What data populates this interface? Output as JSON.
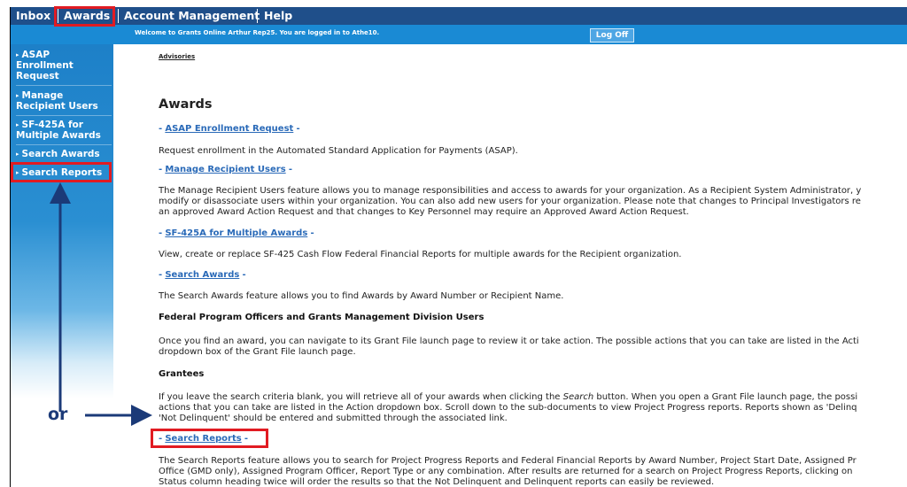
{
  "tabs": [
    {
      "label": "Inbox"
    },
    {
      "label": "Awards"
    },
    {
      "label": "Account Management"
    },
    {
      "label": "Help"
    }
  ],
  "welcome": {
    "text": "Welcome to Grants Online Arthur Rep25. You are logged in to Athe10.",
    "logoff_label": "Log Off"
  },
  "sidebar": {
    "items": [
      {
        "line1": "ASAP",
        "line2": "Enrollment",
        "line3": "Request"
      },
      {
        "line1": "Manage",
        "line2": "Recipient Users"
      },
      {
        "line1": "SF-425A for",
        "line2": "Multiple Awards"
      },
      {
        "line1": "Search Awards"
      },
      {
        "line1": "Search Reports"
      }
    ]
  },
  "content": {
    "advisories": "Advisories",
    "heading": "Awards",
    "asap_link": "ASAP Enrollment Request",
    "asap_desc": "Request enrollment in the Automated Standard Application for Payments (ASAP).",
    "manage_link": "Manage Recipient Users",
    "manage_desc1": "The Manage Recipient Users feature allows you to manage responsibilities and access to awards for your organization. As a Recipient System Administrator, y",
    "manage_desc2": "modify or disassociate users within your organization. You can also add new users for your organization. Please note that changes to Principal Investigators re",
    "manage_desc3": "an approved Award Action Request and that changes to Key Personnel may require an Approved Award Action Request.",
    "sf425_link": "SF-425A for Multiple Awards",
    "sf425_desc": "View, create or replace SF-425 Cash Flow Federal Financial Reports for multiple awards for the Recipient organization.",
    "search_awards_link": "Search Awards",
    "search_awards_desc": "The Search Awards feature allows you to find Awards by Award Number or Recipient Name.",
    "fpo_heading": "Federal Program Officers and Grants Management Division Users",
    "fpo_desc1": "Once you find an award, you can navigate to its Grant File launch page to review it or take action. The possible actions that you can take are listed in the Acti",
    "fpo_desc2": "dropdown box of the Grant File launch page.",
    "grantees_heading": "Grantees",
    "grantees_desc1a": "If you leave the search criteria blank, you will retrieve all of your awards when clicking the ",
    "grantees_desc1_em": "Search",
    "grantees_desc1b": " button. When you open a Grant File launch page, the possi",
    "grantees_desc2": "actions that you can take are listed in the Action dropdown box. Scroll down to the sub-documents to view Project Progress reports. Reports shown as 'Delinq",
    "grantees_desc3": "'Not Delinquent' should be entered and submitted through the associated link.",
    "search_reports_link": "Search Reports",
    "search_reports_desc1": "The Search Reports feature allows you to search for Project Progress Reports and Federal Financial Reports by Award Number, Project Start Date, Assigned Pr",
    "search_reports_desc2": "Office (GMD only), Assigned Program Officer, Report Type or any combination. After results are returned for a search on Project Progress Reports, clicking on",
    "search_reports_desc3": "Status column heading twice will order the results so that the Not Delinquent and Delinquent reports can easily be reviewed.",
    "dash": "-"
  },
  "annotation": {
    "or_label": "or"
  },
  "colors": {
    "tab_bar": "#1f4f8a",
    "welcome_bar": "#1a8ad4",
    "highlight": "#e11b22",
    "arrow": "#1b3a78",
    "link": "#2a6ab8"
  }
}
